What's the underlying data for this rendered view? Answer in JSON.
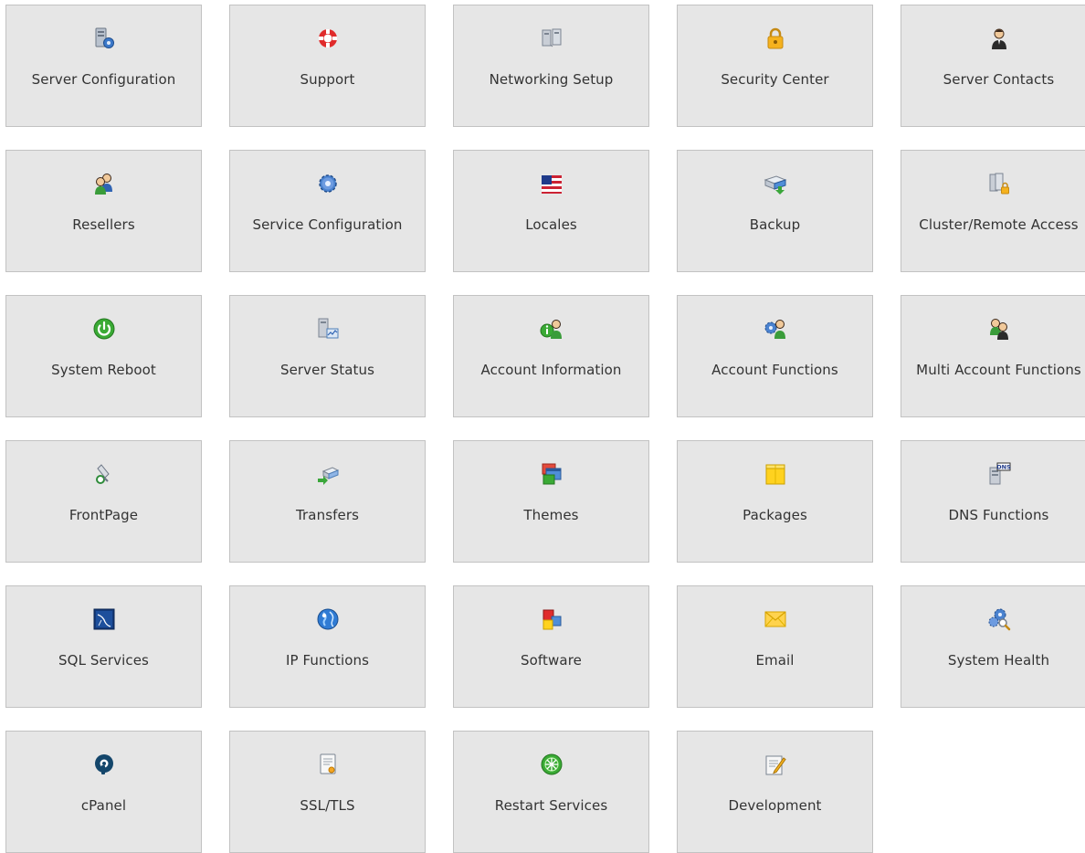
{
  "tiles": [
    {
      "label": "Server Configuration",
      "icon": "server-config-icon"
    },
    {
      "label": "Support",
      "icon": "lifebuoy-icon"
    },
    {
      "label": "Networking Setup",
      "icon": "network-icon"
    },
    {
      "label": "Security Center",
      "icon": "padlock-icon"
    },
    {
      "label": "Server Contacts",
      "icon": "contact-person-icon"
    },
    {
      "label": "Resellers",
      "icon": "users-icon"
    },
    {
      "label": "Service Configuration",
      "icon": "gear-icon"
    },
    {
      "label": "Locales",
      "icon": "flag-icon"
    },
    {
      "label": "Backup",
      "icon": "backup-drive-icon"
    },
    {
      "label": "Cluster/Remote Access",
      "icon": "server-lock-icon"
    },
    {
      "label": "System Reboot",
      "icon": "power-icon"
    },
    {
      "label": "Server Status",
      "icon": "server-status-icon"
    },
    {
      "label": "Account Information",
      "icon": "user-info-icon"
    },
    {
      "label": "Account Functions",
      "icon": "user-gear-icon"
    },
    {
      "label": "Multi Account Functions",
      "icon": "multi-users-icon"
    },
    {
      "label": "FrontPage",
      "icon": "frontpage-icon"
    },
    {
      "label": "Transfers",
      "icon": "transfer-icon"
    },
    {
      "label": "Themes",
      "icon": "windows-icon"
    },
    {
      "label": "Packages",
      "icon": "package-box-icon"
    },
    {
      "label": "DNS Functions",
      "icon": "dns-server-icon"
    },
    {
      "label": "SQL Services",
      "icon": "mysql-icon"
    },
    {
      "label": "IP Functions",
      "icon": "globe-icon"
    },
    {
      "label": "Software",
      "icon": "cubes-icon"
    },
    {
      "label": "Email",
      "icon": "envelope-icon"
    },
    {
      "label": "System Health",
      "icon": "gears-magnifier-icon"
    },
    {
      "label": "cPanel",
      "icon": "cpanel-logo-icon"
    },
    {
      "label": "SSL/TLS",
      "icon": "certificate-icon"
    },
    {
      "label": "Restart Services",
      "icon": "restart-icon"
    },
    {
      "label": "Development",
      "icon": "notepad-pencil-icon"
    }
  ]
}
